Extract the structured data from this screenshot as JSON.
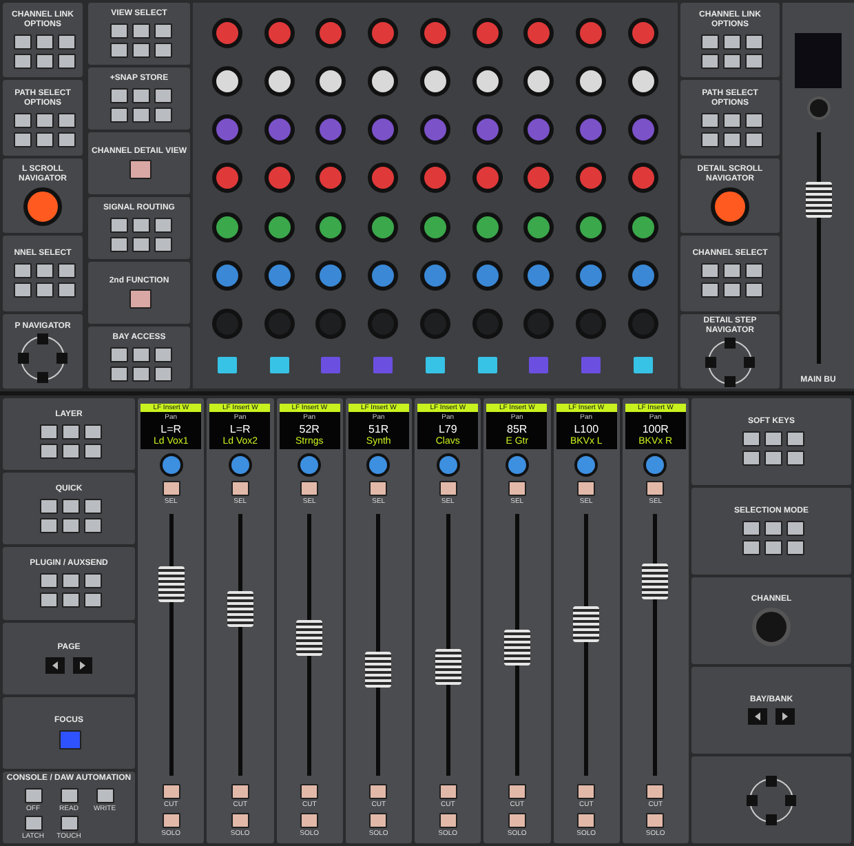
{
  "top_left": [
    {
      "title": "CHANNEL LINK OPTIONS",
      "kind": "keys"
    },
    {
      "title": "PATH SELECT OPTIONS",
      "kind": "keys"
    },
    {
      "title": "L SCROLL NAVIGATOR",
      "kind": "knob"
    },
    {
      "title": "NNEL SELECT",
      "kind": "keys"
    },
    {
      "title": "P NAVIGATOR",
      "kind": "pad"
    }
  ],
  "top_mid": [
    {
      "title": "VIEW SELECT",
      "kind": "keys"
    },
    {
      "title": "+SNAP STORE",
      "kind": "keys"
    },
    {
      "title": "CHANNEL DETAIL VIEW",
      "kind": "key"
    },
    {
      "title": "SIGNAL ROUTING",
      "kind": "keys"
    },
    {
      "title": "2nd FUNCTION",
      "kind": "key"
    },
    {
      "title": "BAY ACCESS",
      "kind": "keys"
    }
  ],
  "knob_rows": [
    {
      "color": "#e0393a"
    },
    {
      "color": "#d9d9d9"
    },
    {
      "color": "#7b52c8"
    },
    {
      "color": "#e0393a"
    },
    {
      "color": "#3ba84b"
    },
    {
      "color": "#3a88d6"
    },
    {
      "color": "#1e1f21"
    }
  ],
  "key_row": [
    {
      "color": "#37c3e6"
    },
    {
      "color": "#37c3e6"
    },
    {
      "color": "#6b4fe0"
    },
    {
      "color": "#6b4fe0"
    },
    {
      "color": "#37c3e6"
    },
    {
      "color": "#37c3e6"
    },
    {
      "color": "#6b4fe0"
    },
    {
      "color": "#6b4fe0"
    },
    {
      "color": "#37c3e6"
    }
  ],
  "top_right": [
    {
      "title": "CHANNEL LINK OPTIONS",
      "kind": "keys"
    },
    {
      "title": "PATH SELECT OPTIONS",
      "kind": "keys"
    },
    {
      "title": "DETAIL SCROLL NAVIGATOR",
      "kind": "knob"
    },
    {
      "title": "CHANNEL SELECT",
      "kind": "keys"
    },
    {
      "title": "DETAIL STEP NAVIGATOR",
      "kind": "pad"
    }
  ],
  "main_bus": {
    "title": "MAIN BU",
    "level": 0.75
  },
  "bottom_left": [
    {
      "title": "LAYER",
      "kind": "keys"
    },
    {
      "title": "QUICK",
      "kind": "keys"
    },
    {
      "title": "PLUGIN / AUXSEND",
      "kind": "keys"
    },
    {
      "title": "PAGE",
      "kind": "arrows"
    },
    {
      "title": "FOCUS",
      "kind": "focus"
    },
    {
      "title": "CONSOLE / DAW AUTOMATION",
      "kind": "auto",
      "buttons": [
        "OFF",
        "READ",
        "WRITE",
        "LATCH",
        "TOUCH"
      ]
    }
  ],
  "strips": [
    {
      "header": "LF Insert W",
      "param": "Pan",
      "value": "L=R",
      "name": "Ld Vox1",
      "sel": "SEL",
      "cut": "CUT",
      "solo": "SOLO",
      "level": 0.77
    },
    {
      "header": "LF Insert W",
      "param": "Pan",
      "value": "L=R",
      "name": "Ld Vox2",
      "sel": "SEL",
      "cut": "CUT",
      "solo": "SOLO",
      "level": 0.66
    },
    {
      "header": "LF Insert W",
      "param": "Pan",
      "value": "52R",
      "name": "Strngs",
      "sel": "SEL",
      "cut": "CUT",
      "solo": "SOLO",
      "level": 0.53
    },
    {
      "header": "LF Insert W",
      "param": "Pan",
      "value": "51R",
      "name": "Synth",
      "sel": "SEL",
      "cut": "CUT",
      "solo": "SOLO",
      "level": 0.39
    },
    {
      "header": "LF Insert W",
      "param": "Pan",
      "value": "L79",
      "name": "Clavs",
      "sel": "SEL",
      "cut": "CUT",
      "solo": "SOLO",
      "level": 0.4
    },
    {
      "header": "LF Insert W",
      "param": "Pan",
      "value": "85R",
      "name": "E Gtr",
      "sel": "SEL",
      "cut": "CUT",
      "solo": "SOLO",
      "level": 0.49
    },
    {
      "header": "LF Insert W",
      "param": "Pan",
      "value": "L100",
      "name": "BKVx L",
      "sel": "SEL",
      "cut": "CUT",
      "solo": "SOLO",
      "level": 0.59
    },
    {
      "header": "LF Insert W",
      "param": "Pan",
      "value": "100R",
      "name": "BKVx R",
      "sel": "SEL",
      "cut": "CUT",
      "solo": "SOLO",
      "level": 0.78
    }
  ],
  "bottom_right": [
    {
      "title": "SOFT KEYS",
      "kind": "keys"
    },
    {
      "title": "SELECTION MODE",
      "kind": "keys"
    },
    {
      "title": "CHANNEL",
      "kind": "dial"
    },
    {
      "title": "BAY/BANK",
      "kind": "arrows"
    },
    {
      "kind": "pad"
    }
  ]
}
